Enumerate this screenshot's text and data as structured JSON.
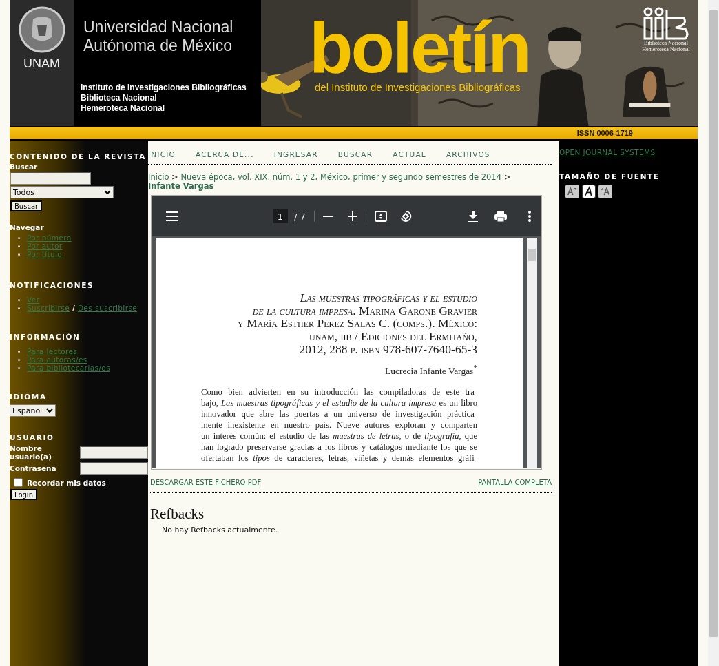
{
  "banner": {
    "institution_lines": [
      "Universidad Nacional",
      "Autónoma de México"
    ],
    "crest_label": "UNAM",
    "departments": [
      "Instituto de Investigaciones Bibliográficas",
      "Biblioteca Nacional",
      "Hemeroteca Nacional"
    ],
    "title": "boletín",
    "subtitle": "del Instituto de Investigaciones Bibliográficas",
    "logo_lines": [
      "Biblioteca Nacional",
      "Hemeroteca Nacional"
    ],
    "issn": "ISSN 0006-1719"
  },
  "left_sidebar": {
    "journal_heading": "CONTENIDO DE LA REVISTA",
    "search_label": "Buscar",
    "search_scope": "Todos",
    "search_button": "Buscar",
    "browse_label": "Navegar",
    "browse_links": [
      "Por número",
      "Por autor",
      "Por título"
    ],
    "notifications_heading": "NOTIFICACIONES",
    "notification_items": [
      {
        "links": [
          "Ver"
        ]
      },
      {
        "links": [
          "Suscribirse",
          "Des-suscribirse"
        ],
        "separator": "/"
      }
    ],
    "information_heading": "INFORMACIÓN",
    "information_links": [
      "Para lectores",
      "Para autoras/es",
      "Para bibliotecarias/os"
    ],
    "language_heading": "IDIOMA",
    "language": "Español",
    "user_heading": "USUARIO",
    "username_label": "Nombre usuario(a)",
    "password_label": "Contraseña",
    "remember_label": "Recordar mis datos",
    "remember_checked": false,
    "login_button": "Login"
  },
  "nav": {
    "items": [
      "INICIO",
      "ACERCA DE...",
      "INGRESAR",
      "BUSCAR",
      "ACTUAL",
      "ARCHIVOS"
    ]
  },
  "breadcrumb": [
    {
      "kind": "link",
      "text": "Inicio"
    },
    {
      "kind": "separator",
      "text": ">"
    },
    {
      "kind": "link",
      "text": "Nueva época, vol. XIX, núm. 1 y 2, México, primer y segundo semestres de 2014"
    },
    {
      "kind": "separator",
      "text": ">"
    },
    {
      "kind": "current",
      "text": "Infante Vargas"
    }
  ],
  "pdf_viewer": {
    "page": "1",
    "page_count": "/ 7",
    "title_lines": [
      "*Las muestras tipográficas y el estudio*",
      "*de la cultura impresa*. Marina Garone Gravier",
      "y María Esther Pérez Salas C. (comps.). México:",
      "unam, iib / Ediciones del Ermitaño,",
      "2012, 288 p. isbn 978-607-7640-65-3"
    ],
    "author": "Lucrecia Infante Vargas$^{*}$",
    "paragraph_lines": [
      "Como bien advierten en su introducción las compiladoras de este tra-",
      "bajo, *Las muestras tipográficas y el estudio de la cultura impresa* es un libro",
      "innovador que abre las puertas a un universo de investigación práctica-",
      "mente inexistente en nuestro país. Nueve autores exploran y comparten",
      "un interés común: el estudio de las *muestras de letras,* o de *tipografía,* que",
      "han logrado preservarse gracias a los libros y catálogos mediante los que se",
      "ofertaban los *tipos* de caracteres, letras, viñetas y demás elementos gráfi-"
    ]
  },
  "article_links": {
    "download": "DESCARGAR ESTE FICHERO PDF",
    "fullscreen": "PANTALLA COMPLETA"
  },
  "refbacks": {
    "heading": "Refbacks",
    "message": "No hay Refbacks actualmente."
  },
  "right_sidebar": {
    "ojs_link": "OPEN JOURNAL SYSTEMS",
    "font_size_heading": "TAMAÑO DE FUENTE",
    "font_size_buttons": [
      {
        "kind": "small",
        "selected": false
      },
      {
        "kind": "default",
        "selected": true
      },
      {
        "kind": "large",
        "selected": false
      }
    ]
  }
}
